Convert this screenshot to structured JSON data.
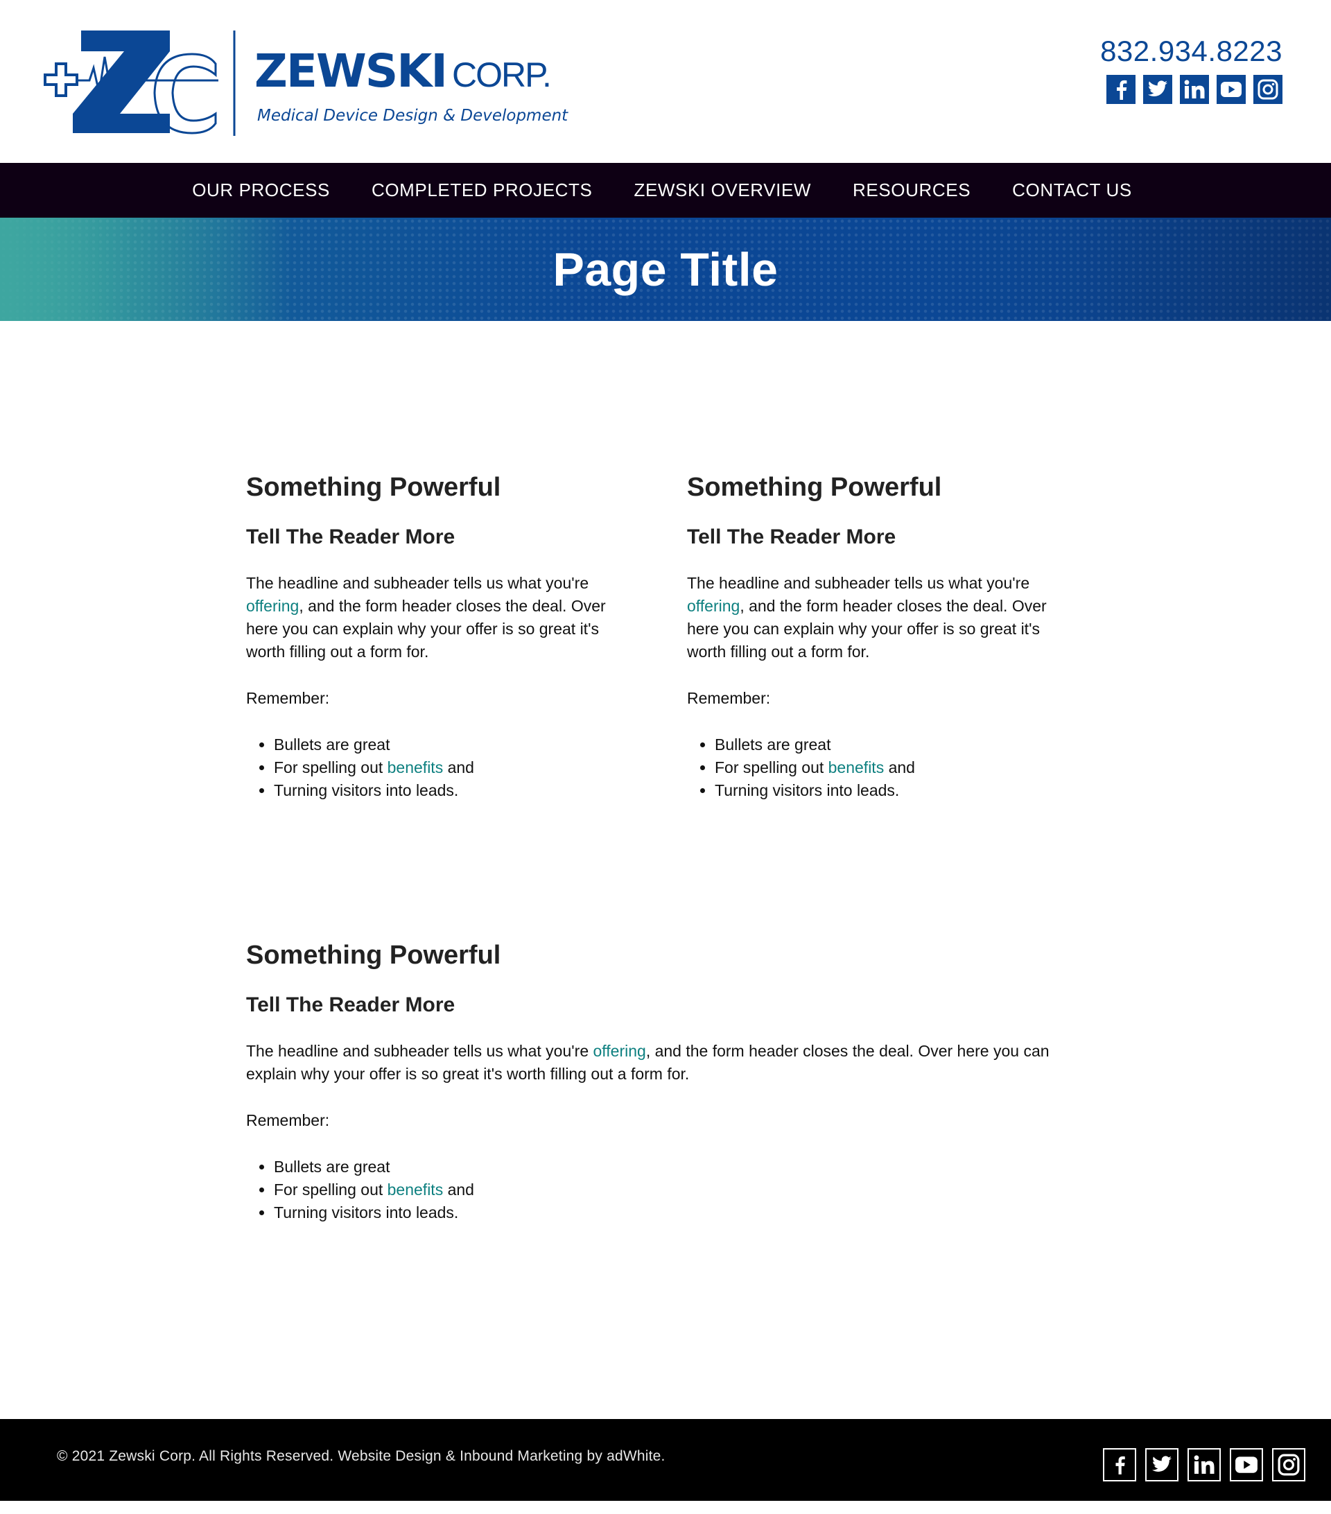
{
  "brand": {
    "name": "ZEWSKI",
    "corp": "CORP.",
    "tagline": "Medical Device Design & Development",
    "logo_monogram": "ZC",
    "primary_color": "#0b4795",
    "accent_color": "#0e8080"
  },
  "header": {
    "phone": "832.934.8223",
    "social": [
      {
        "icon": "facebook-icon"
      },
      {
        "icon": "twitter-icon"
      },
      {
        "icon": "linkedin-icon"
      },
      {
        "icon": "youtube-icon"
      },
      {
        "icon": "instagram-icon"
      }
    ]
  },
  "nav": {
    "items": [
      {
        "label": "OUR PROCESS"
      },
      {
        "label": "COMPLETED PROJECTS"
      },
      {
        "label": "ZEWSKI OVERVIEW"
      },
      {
        "label": "RESOURCES"
      },
      {
        "label": "CONTACT US"
      }
    ]
  },
  "hero": {
    "title": "Page Title"
  },
  "blocks": [
    {
      "heading": "Something Powerful",
      "subheading": "Tell The Reader More",
      "body_before": "The headline and subheader tells us what you're ",
      "body_link": "offering",
      "body_after": ", and the form header closes the deal. Over here you can explain why your offer is so great it's worth filling out a form for.",
      "remember": "Remember:",
      "bullets": {
        "item1": "Bullets are great",
        "item2_before": "For spelling out ",
        "item2_link": "benefits",
        "item2_after": " and",
        "item3": "Turning visitors into leads."
      }
    },
    {
      "heading": "Something Powerful",
      "subheading": "Tell The Reader More",
      "body_before": "The headline and subheader tells us what you're ",
      "body_link": "offering",
      "body_after": ", and the form header closes the deal. Over here you can explain why your offer is so great it's worth filling out a form for.",
      "remember": "Remember:",
      "bullets": {
        "item1": "Bullets are great",
        "item2_before": "For spelling out ",
        "item2_link": "benefits",
        "item2_after": " and",
        "item3": "Turning visitors into leads."
      }
    },
    {
      "heading": "Something Powerful",
      "subheading": "Tell The Reader More",
      "body_before": "The headline and subheader tells us what you're ",
      "body_link": "offering",
      "body_after": ", and the form header closes the deal. Over here you can explain why your offer is so great it's worth filling out a form for.",
      "remember": "Remember:",
      "bullets": {
        "item1": "Bullets are great",
        "item2_before": "For spelling out ",
        "item2_link": "benefits",
        "item2_after": " and",
        "item3": "Turning visitors into leads."
      }
    }
  ],
  "footer": {
    "copyright": "© 2021 Zewski Corp. All Rights Reserved. Website Design & Inbound Marketing by adWhite.",
    "social": [
      {
        "icon": "facebook-icon"
      },
      {
        "icon": "twitter-icon"
      },
      {
        "icon": "linkedin-icon"
      },
      {
        "icon": "youtube-icon"
      },
      {
        "icon": "instagram-icon"
      }
    ]
  }
}
